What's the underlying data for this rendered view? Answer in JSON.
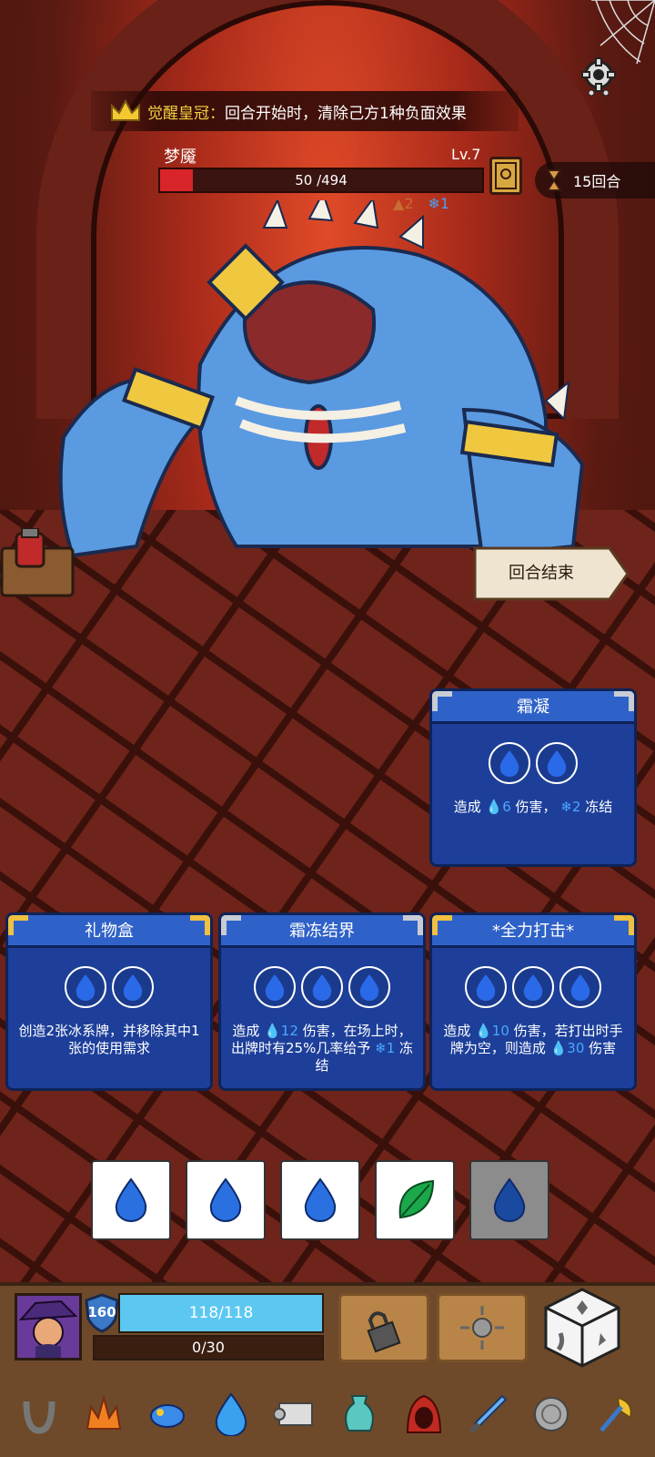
{
  "buff": {
    "name": "觉醒皇冠：",
    "description": "回合开始时，清除己方1种负面效果"
  },
  "enemy": {
    "name": "梦魇",
    "level": "Lv.7",
    "hp_text": "50 /494",
    "hp_fraction": 0.101,
    "status_strength": "2",
    "status_freeze": "1"
  },
  "turn": {
    "label": "15回合"
  },
  "end_turn": {
    "label": "回合结束"
  },
  "cards": [
    {
      "title": "霜凝",
      "cost": 2,
      "desc_parts": [
        "造成 ",
        "6",
        " 伤害，",
        "2",
        " 冻结"
      ]
    },
    {
      "title": "礼物盒",
      "cost": 2,
      "desc": "创造2张冰系牌，并移除其中1张的使用需求"
    },
    {
      "title": "霜冻结界",
      "cost": 3,
      "desc_parts": [
        "造成 ",
        "12",
        " 伤害，在场上时，出牌时有25%几率给予",
        "1",
        " 冻结"
      ]
    },
    {
      "title": "*全力打击*",
      "cost": 3,
      "desc_parts": [
        "造成 ",
        "10",
        " 伤害，若打出时手牌为空，则造成",
        "30",
        " 伤害"
      ]
    }
  ],
  "dice": [
    "water",
    "water",
    "water",
    "leaf",
    "water-used"
  ],
  "player": {
    "armor": "160",
    "hp_text": "118/118",
    "xp_text": "0/30"
  },
  "colors": {
    "card_bg": "#1d3f9a",
    "card_header": "#2f62c8",
    "hp_bar": "#d9242a",
    "player_hp": "#5cc8f2",
    "highlight": "#4aa8ff"
  },
  "relics": [
    "horseshoe-icon",
    "fire-crown-icon",
    "blue-fish-icon",
    "water-drop-icon",
    "scroll-icon",
    "vase-icon",
    "red-hood-icon",
    "ice-sword-icon",
    "coin-icon",
    "golden-axe-icon"
  ]
}
